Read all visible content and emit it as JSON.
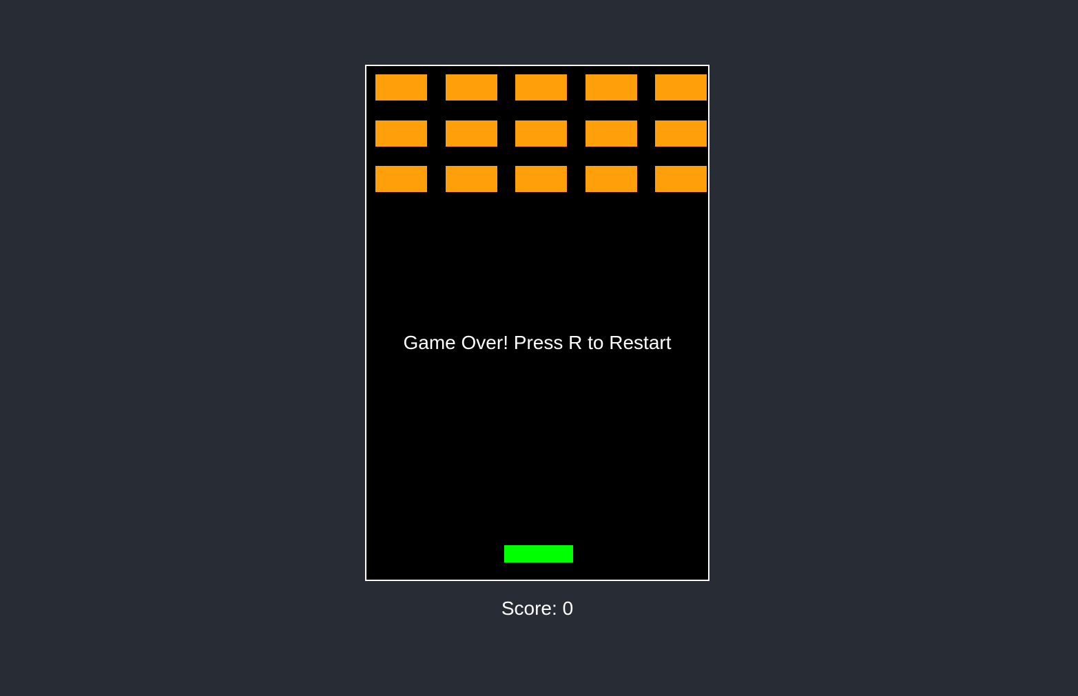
{
  "colors": {
    "page_background": "#282c34",
    "board_background": "#000000",
    "board_border": "#ffffff",
    "brick": "#ff9f0a",
    "paddle": "#00ff00",
    "text": "#ffffff"
  },
  "game": {
    "status_message": "Game Over! Press R to Restart",
    "score_label": "Score: ",
    "score_value": "0",
    "bricks": {
      "rows": 3,
      "columns": 5,
      "remaining": 15
    }
  }
}
